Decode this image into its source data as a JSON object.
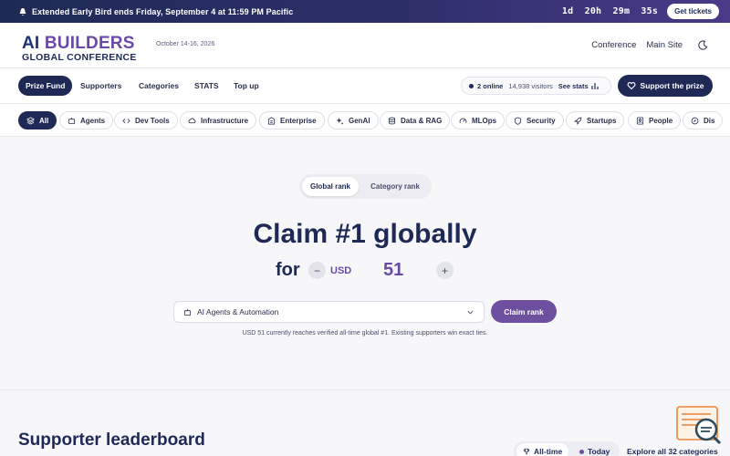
{
  "banner": {
    "message": "Extended Early Bird ends Friday, September 4 at 11:59 PM Pacific",
    "countdown": {
      "days": "1d",
      "hours": "20h",
      "minutes": "29m",
      "seconds": "35s"
    },
    "tickets_label": "Get tickets"
  },
  "header": {
    "logo_line1_a": "AI",
    "logo_line1_b": "BUILDERS",
    "logo_line2": "GLOBAL CONFERENCE",
    "dates": "October 14-16, 2026",
    "nav": [
      "Conference",
      "Main Site"
    ]
  },
  "mainnav": {
    "items": [
      "Prize Fund",
      "Supporters",
      "Categories",
      "STATS",
      "Top up"
    ],
    "online": "2 online",
    "visitors": "14,938 visitors",
    "see_stats": "See stats",
    "support_label": "Support the prize"
  },
  "chips": [
    "All",
    "Agents",
    "Dev Tools",
    "Infrastructure",
    "Enterprise",
    "GenAI",
    "Data & RAG",
    "MLOps",
    "Security",
    "Startups",
    "People",
    "Dis"
  ],
  "hero": {
    "tabs": [
      "Global rank",
      "Category rank"
    ],
    "title": "Claim #1 globally",
    "for_label": "for",
    "minus": "−",
    "plus": "+",
    "currency": "USD",
    "amount": "51",
    "category": "AI Agents & Automation",
    "claim_label": "Claim rank",
    "hint": "USD 51 currently reaches verified all-time global #1. Existing supporters win exact ties."
  },
  "leaderboard": {
    "title": "Supporter leaderboard",
    "tabs": [
      "All-time",
      "Today"
    ],
    "explore": "Explore all 32 categories"
  },
  "colors": {
    "navy": "#1e2a55",
    "purple": "#6e4fa0",
    "accent_orange": "#e8843a"
  }
}
